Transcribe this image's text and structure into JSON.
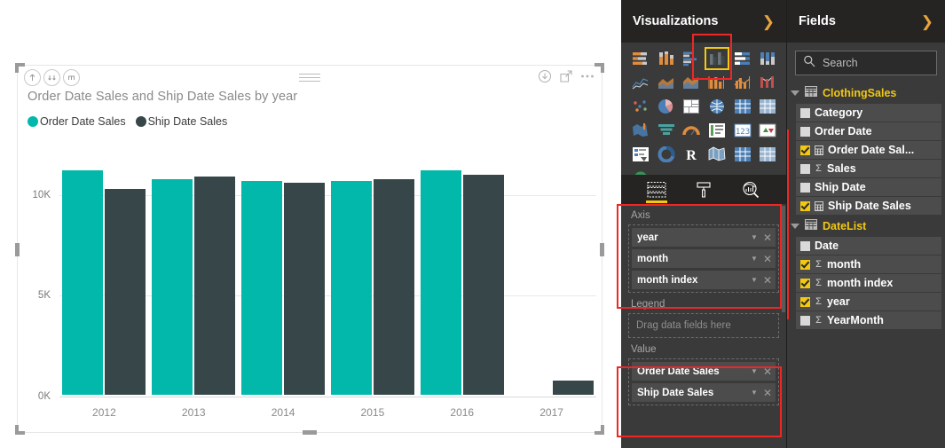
{
  "visual": {
    "title": "Order Date Sales and Ship Date Sales by year",
    "drill_icons": [
      "drill-up-icon",
      "drill-down-icon",
      "expand-hierarchy-icon"
    ],
    "action_icons": [
      "download-icon",
      "focus-mode-icon",
      "more-options-icon"
    ],
    "legend": [
      {
        "label": "Order Date Sales",
        "color": "#01B8AA"
      },
      {
        "label": "Ship Date Sales",
        "color": "#374649"
      }
    ]
  },
  "chart_data": {
    "type": "bar",
    "title": "Order Date Sales and Ship Date Sales by year",
    "xlabel": "year",
    "ylabel": "",
    "categories": [
      "2012",
      "2013",
      "2014",
      "2015",
      "2016",
      "2017"
    ],
    "series": [
      {
        "name": "Order Date Sales",
        "color": "#01B8AA",
        "values": [
          11100,
          10700,
          10600,
          10600,
          11100,
          0
        ]
      },
      {
        "name": "Ship Date Sales",
        "color": "#374649",
        "values": [
          10200,
          10800,
          10500,
          10700,
          10900,
          700
        ]
      }
    ],
    "ytick_labels": [
      "0K",
      "5K",
      "10K"
    ],
    "ytick_values": [
      0,
      5000,
      10000
    ],
    "ylim": [
      0,
      12000
    ],
    "grid": true,
    "legend_position": "top-left"
  },
  "visualizations": {
    "header": "Visualizations",
    "chevron": "chevron-right-icon",
    "selected_icon": "clustered-column-chart-icon",
    "icons": [
      "stacked-bar-chart-icon",
      "stacked-column-chart-icon",
      "clustered-bar-chart-icon",
      "clustered-column-chart-icon",
      "100-percent-stacked-bar-chart-icon",
      "100-percent-stacked-column-chart-icon",
      "line-chart-icon",
      "area-chart-icon",
      "stacked-area-chart-icon",
      "line-and-stacked-column-chart-icon",
      "line-and-clustered-column-chart-icon",
      "ribbon-chart-icon",
      "scatter-chart-icon",
      "pie-chart-icon",
      "treemap-icon",
      "map-icon",
      "table-icon",
      "matrix-icon",
      "filled-map-icon",
      "funnel-icon",
      "gauge-icon",
      "multi-row-card-icon",
      "card-icon",
      "kpi-icon",
      "slicer-icon",
      "donut-chart-icon",
      "r-script-visual-icon",
      "shape-map-icon",
      "table-alt-icon",
      "matrix-alt-icon",
      "arcgis-map-icon",
      "more-visuals-icon"
    ],
    "well_tabs": [
      "fields-tab-icon",
      "format-tab-icon",
      "analytics-tab-icon"
    ],
    "active_well_tab": "fields-tab-icon",
    "wells": [
      {
        "name": "Axis",
        "highlighted": true,
        "fields": [
          "year",
          "month",
          "month index"
        ],
        "placeholder": ""
      },
      {
        "name": "Legend",
        "highlighted": false,
        "fields": [],
        "placeholder": "Drag data fields here"
      },
      {
        "name": "Value",
        "highlighted": true,
        "fields": [
          "Order Date Sales",
          "Ship Date Sales"
        ],
        "placeholder": ""
      }
    ]
  },
  "fields": {
    "header": "Fields",
    "chevron": "chevron-right-icon",
    "search": {
      "placeholder": "Search",
      "value": "",
      "icon": "search-icon"
    },
    "tables": [
      {
        "name": "ClothingSales",
        "expanded": true,
        "items": [
          {
            "label": "Category",
            "checked": false,
            "kind": "column"
          },
          {
            "label": "Order Date",
            "checked": false,
            "kind": "column"
          },
          {
            "label": "Order Date Sal...",
            "checked": true,
            "kind": "measure"
          },
          {
            "label": "Sales",
            "checked": false,
            "kind": "sum"
          },
          {
            "label": "Ship Date",
            "checked": false,
            "kind": "column"
          },
          {
            "label": "Ship Date Sales",
            "checked": true,
            "kind": "measure"
          }
        ]
      },
      {
        "name": "DateList",
        "expanded": true,
        "items": [
          {
            "label": "Date",
            "checked": false,
            "kind": "column"
          },
          {
            "label": "month",
            "checked": true,
            "kind": "sum"
          },
          {
            "label": "month index",
            "checked": true,
            "kind": "sum"
          },
          {
            "label": "year",
            "checked": true,
            "kind": "sum"
          },
          {
            "label": "YearMonth",
            "checked": false,
            "kind": "sum"
          }
        ]
      }
    ]
  },
  "colors": {
    "accent_teal": "#01B8AA",
    "accent_dark": "#374649",
    "highlight_yellow": "#F2C811",
    "annotation_red": "#EF2626",
    "pane_bg": "#3A3A3A",
    "pane_header_bg": "#252423"
  }
}
